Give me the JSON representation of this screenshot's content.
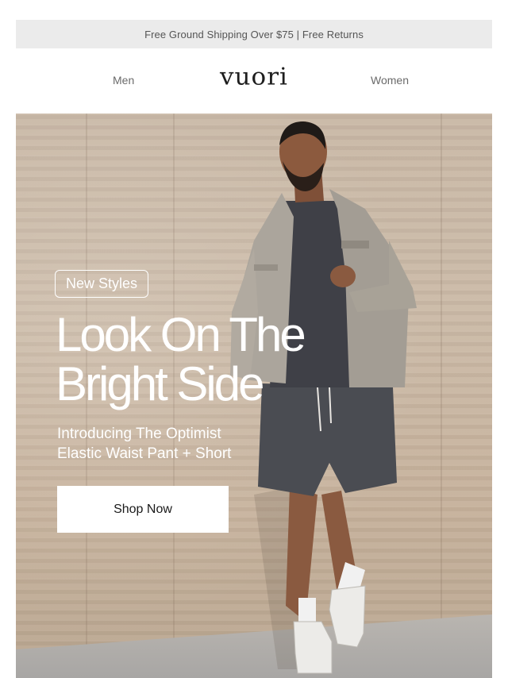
{
  "promo": {
    "text": "Free Ground Shipping Over $75 | Free Returns"
  },
  "nav": {
    "men": "Men",
    "logo": "vuori",
    "women": "Women"
  },
  "hero": {
    "badge": "New Styles",
    "headline_line1": "Look On The",
    "headline_line2": "Bright Side",
    "subhead_line1": "Introducing The Optimist",
    "subhead_line2": "Elastic Waist Pant + Short",
    "cta": "Shop Now"
  },
  "colors": {
    "promo_bg": "#ebebeb",
    "wall": "#c9b8a6",
    "jacket": "#a9a39b",
    "sweater": "#3f4047",
    "shorts": "#4a4c52",
    "cta_bg": "#ffffff"
  }
}
